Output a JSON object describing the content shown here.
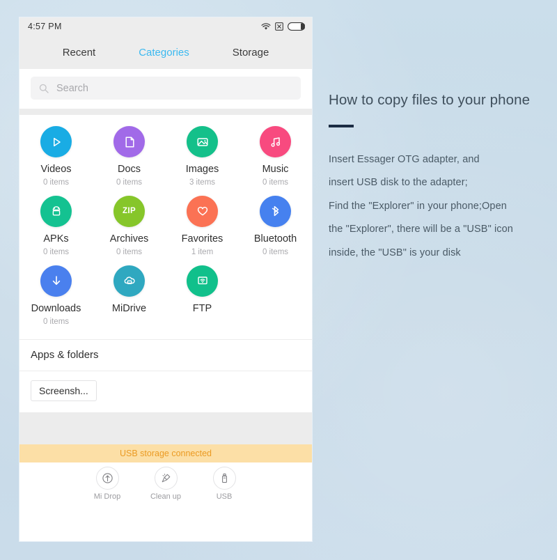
{
  "background_color": "#c9dcea",
  "phone": {
    "status_bar": {
      "clock": "4:57 PM",
      "icons": [
        "wifi-icon",
        "no-sim-icon",
        "battery-icon"
      ]
    },
    "tabs": [
      {
        "label": "Recent",
        "active": false
      },
      {
        "label": "Categories",
        "active": true
      },
      {
        "label": "Storage",
        "active": false
      }
    ],
    "active_tab_color": "#3bb9f0",
    "search": {
      "icon": "search-icon",
      "placeholder": "Search",
      "value": ""
    },
    "categories": [
      {
        "label": "Videos",
        "sub": "0 items",
        "color": "#19ace4",
        "icon": "play-icon"
      },
      {
        "label": "Docs",
        "sub": "0 items",
        "color": "#a濃",
        "icon": "document-icon"
      },
      {
        "label": "Images",
        "sub": "3 items",
        "color": "#14c08a",
        "icon": "image-icon"
      },
      {
        "label": "Music",
        "sub": "0 items",
        "color": "#f84a7f",
        "icon": "music-note-icon"
      },
      {
        "label": "APKs",
        "sub": "0 items",
        "color": "#14c291",
        "icon": "android-icon"
      },
      {
        "label": "Archives",
        "sub": "0 items",
        "color": "#86c62a",
        "icon": "zip-icon"
      },
      {
        "label": "Favorites",
        "sub": "1 item",
        "color": "#fb7254",
        "icon": "heart-icon"
      },
      {
        "label": "Bluetooth",
        "sub": "0 items",
        "color": "#4681ef",
        "icon": "bluetooth-icon"
      },
      {
        "label": "Downloads",
        "sub": "0 items",
        "color": "#4a80ee",
        "icon": "download-arrow-icon"
      },
      {
        "label": "MiDrive",
        "sub": "",
        "color": "#2fa8c0",
        "icon": "cloud-drive-icon"
      },
      {
        "label": "FTP",
        "sub": "",
        "color": "#11c08b",
        "icon": "ftp-wifi-icon"
      }
    ],
    "apps_section": {
      "title": "Apps & folders",
      "chips": [
        "Screensh..."
      ]
    },
    "usb_banner": {
      "text": "USB storage connected",
      "bg_color": "#fcdfa6",
      "text_color": "#eb9b23"
    },
    "bottom_toolbar": [
      {
        "label": "Mi Drop",
        "icon": "mi-drop-icon"
      },
      {
        "label": "Clean up",
        "icon": "broom-icon"
      },
      {
        "label": "USB",
        "icon": "usb-drive-icon"
      }
    ]
  },
  "panel": {
    "title": "How to copy files to your phone",
    "rule_color": "#1b2c44",
    "lines": [
      "Insert Essager OTG adapter, and",
      "insert USB disk to the adapter;",
      "Find the \"Explorer\" in your phone;Open",
      "the \"Explorer\", there will be a \"USB\" icon",
      "inside, the \"USB\" is your disk"
    ]
  }
}
